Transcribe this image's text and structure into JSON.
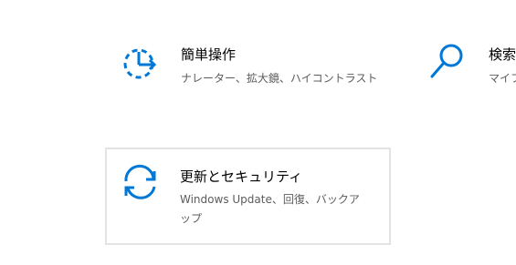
{
  "accent_color": "#0078d7",
  "tiles": [
    {
      "icon": "ease-of-access-icon",
      "title": "簡単操作",
      "description": "ナレーター、拡大鏡、ハイコントラスト"
    },
    {
      "icon": "search-icon",
      "title": "検索",
      "description": "マイフ"
    },
    {
      "icon": "update-sync-icon",
      "title": "更新とセキュリティ",
      "description": "Windows Update、回復、バックアップ"
    }
  ]
}
